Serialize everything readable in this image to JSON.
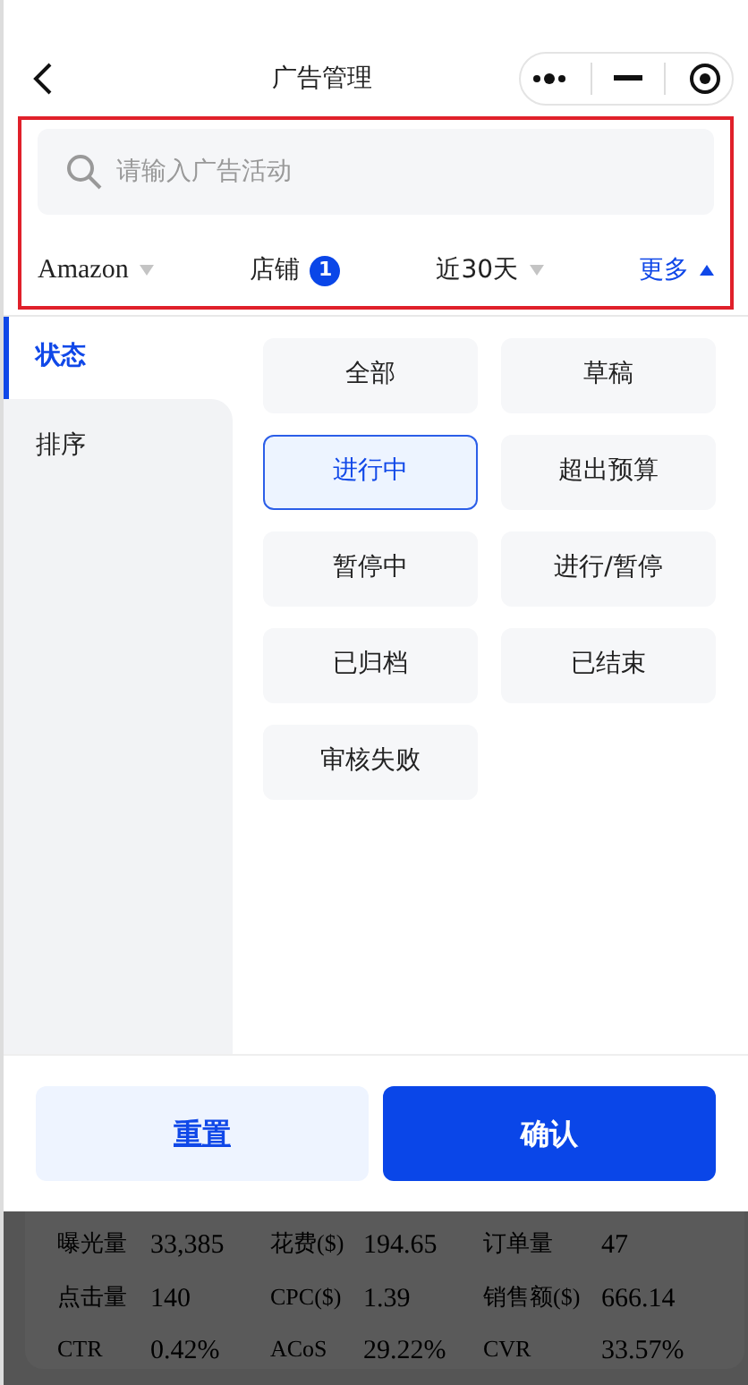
{
  "header": {
    "title": "广告管理"
  },
  "search": {
    "placeholder": "请输入广告活动"
  },
  "filters": [
    {
      "label": "Amazon",
      "kind": "dropdown",
      "expanded": false
    },
    {
      "label": "店铺",
      "kind": "count",
      "badge": "1"
    },
    {
      "label": "近30天",
      "kind": "dropdown",
      "expanded": false
    },
    {
      "label": "更多",
      "kind": "dropdown",
      "expanded": true
    }
  ],
  "sidebar": {
    "items": [
      {
        "label": "状态",
        "selected": true
      },
      {
        "label": "排序",
        "selected": false
      }
    ]
  },
  "options": [
    {
      "label": "全部",
      "selected": false
    },
    {
      "label": "草稿",
      "selected": false
    },
    {
      "label": "进行中",
      "selected": true
    },
    {
      "label": "超出预算",
      "selected": false
    },
    {
      "label": "暂停中",
      "selected": false
    },
    {
      "label": "进行/暂停",
      "selected": false
    },
    {
      "label": "已归档",
      "selected": false
    },
    {
      "label": "已结束",
      "selected": false
    },
    {
      "label": "审核失败",
      "selected": false
    }
  ],
  "buttons": [
    {
      "label": "重置",
      "kind": "secondary"
    },
    {
      "label": "确认",
      "kind": "primary"
    }
  ],
  "stats": [
    [
      {
        "label": "曝光量",
        "value": "33,385"
      },
      {
        "label": "花费($)",
        "value": "194.65"
      },
      {
        "label": "订单量",
        "value": "47"
      }
    ],
    [
      {
        "label": "点击量",
        "value": "140"
      },
      {
        "label": "CPC($)",
        "value": "1.39"
      },
      {
        "label": "销售额($)",
        "value": "666.14"
      }
    ],
    [
      {
        "label": "CTR",
        "value": "0.42%"
      },
      {
        "label": "ACoS",
        "value": "29.22%"
      },
      {
        "label": "CVR",
        "value": "33.57%"
      }
    ]
  ]
}
